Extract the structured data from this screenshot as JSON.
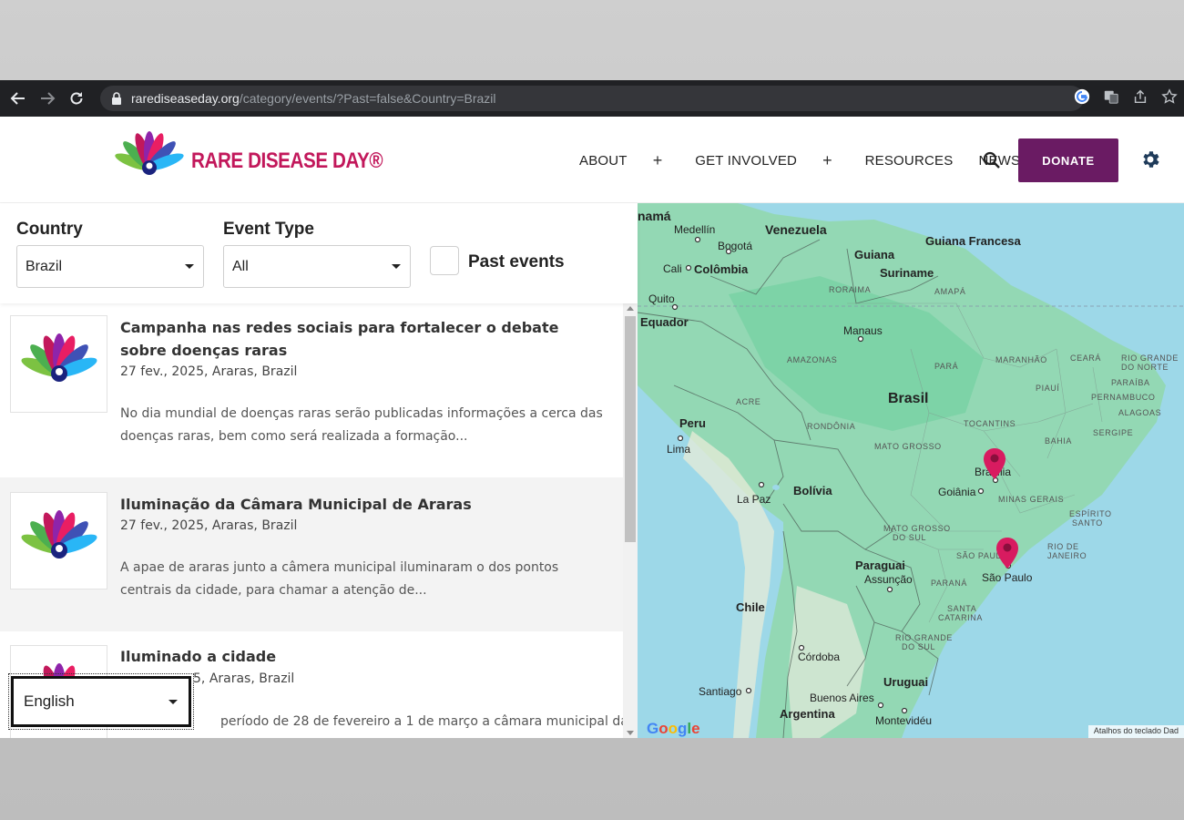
{
  "browser": {
    "url_host": "rarediseaseday.org",
    "url_path": "/category/events/?Past=false&Country=Brazil"
  },
  "header": {
    "logo_text": "RARE DISEASE DAY®",
    "menu": [
      {
        "label": "ABOUT",
        "has_plus": true
      },
      {
        "label": "GET INVOLVED",
        "has_plus": true
      },
      {
        "label": "RESOURCES",
        "has_plus": false
      },
      {
        "label": "NEWS",
        "has_plus": false
      }
    ],
    "plus_symbol": "+",
    "donate_label": "DONATE"
  },
  "filters": {
    "country_label": "Country",
    "country_value": "Brazil",
    "event_type_label": "Event Type",
    "event_type_value": "All",
    "past_events_label": "Past events"
  },
  "events": [
    {
      "title": "Campanha nas redes sociais para fortalecer o debate sobre doenças raras",
      "date": "27 fev., 2025, ",
      "location": "Araras, Brazil",
      "description": "No dia mundial de doenças raras serão publicadas informações a cerca das doenças raras, bem como será realizada a formação..."
    },
    {
      "title": "Iluminação da Câmara Municipal de Araras",
      "date": "27 fev., 2025, ",
      "location": "Araras, Brazil",
      "description": "A apae de araras junto a câmera municipal iluminaram o dos pontos centrais da cidade, para chamar a atenção de..."
    },
    {
      "title": "Iluminado a cidade",
      "date": "5, ",
      "location": "Araras, Brazil",
      "description": "período de 28 de fevereiro a 1 de março a câmara municipal da"
    }
  ],
  "language_select": {
    "value": "English"
  },
  "map": {
    "countries": [
      "Venezuela",
      "Guiana",
      "Suriname",
      "Guiana Francesa",
      "Colômbia",
      "Equador",
      "Peru",
      "Brasil",
      "Bolívia",
      "Paraguai",
      "Chile",
      "Argentina",
      "Uruguai"
    ],
    "cities": [
      "namá",
      "Medellín",
      "Bogotá",
      "Cali",
      "Quito",
      "Manaus",
      "Lima",
      "La Paz",
      "Brasília",
      "Goiânia",
      "São Paulo",
      "Assunção",
      "Córdoba",
      "Santiago",
      "Buenos Aires",
      "Montevidéu"
    ],
    "states": [
      "RORAIMA",
      "AMAPÁ",
      "AMAZONAS",
      "PARÁ",
      "MARANHÃO",
      "CEARÁ",
      "RIO GRANDE",
      "DO NORTE",
      "PARAÍBA",
      "PIAUÍ",
      "PERNAMBUCO",
      "ALAGOAS",
      "ACRE",
      "RONDÔNIA",
      "TOCANTINS",
      "SERGIPE",
      "BAHIA",
      "MATO GROSSO",
      "MINAS GERAIS",
      "ESPÍRITO",
      "SANTO",
      "MATO GROSSO",
      "DO SUL",
      "SÃO PAULO",
      "RIO DE",
      "JANEIRO",
      "PARANÁ",
      "SANTA",
      "CATARINA",
      "RIO GRANDE",
      "DO SUL"
    ],
    "google_text": "Google",
    "attribution": "Atalhos do teclado   Dad"
  },
  "colors": {
    "brand_pink": "#c2185b",
    "donate_purple": "#6a1b63",
    "chrome_dark": "#202124",
    "map_land": "#8fd4b2",
    "map_water": "#9dd8e8",
    "pin": "#d81b60"
  }
}
